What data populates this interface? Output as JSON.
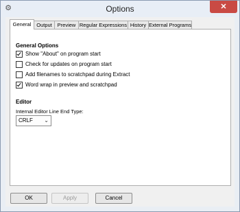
{
  "window": {
    "title": "Options",
    "app_icon": "gear-icon",
    "close_icon": "close-icon",
    "close_glyph": "✕",
    "app_glyph": "⚙"
  },
  "tabs": [
    {
      "label": "General",
      "active": true
    },
    {
      "label": "Output",
      "active": false
    },
    {
      "label": "Preview",
      "active": false
    },
    {
      "label": "Regular Expressions",
      "active": false
    },
    {
      "label": "History",
      "active": false
    },
    {
      "label": "External Programs",
      "active": false
    }
  ],
  "general_options": {
    "heading": "General Options",
    "items": [
      {
        "label": "Show \"About\" on program start",
        "checked": true
      },
      {
        "label": "Check for updates on program start",
        "checked": false
      },
      {
        "label": "Add filenames to scratchpad during Extract",
        "checked": false
      },
      {
        "label": "Word wrap in preview and scratchpad",
        "checked": true
      }
    ]
  },
  "editor": {
    "heading": "Editor",
    "line_end_label": "Internal Editor Line End Type:",
    "line_end_value": "CRLF",
    "chevron_glyph": "⌄"
  },
  "buttons": {
    "ok": "OK",
    "apply": "Apply",
    "cancel": "Cancel"
  }
}
